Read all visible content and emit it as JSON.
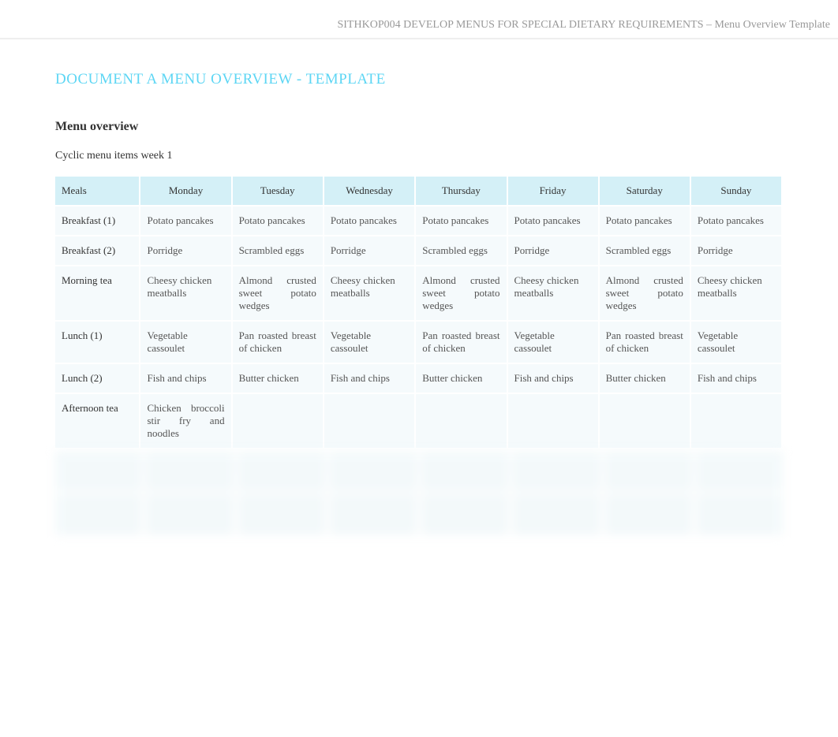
{
  "header_text": "SITHKOP004 DEVELOP MENUS FOR SPECIAL DIETARY REQUIREMENTS – Menu Overview Template",
  "doc_title": "DOCUMENT A MENU OVERVIEW - TEMPLATE",
  "section_heading": "Menu overview",
  "subtext": "Cyclic menu items week 1",
  "table": {
    "headers": [
      "Meals",
      "Monday",
      "Tuesday",
      "Wednesday",
      "Thursday",
      "Friday",
      "Saturday",
      "Sunday"
    ],
    "rows": [
      {
        "label": "Breakfast (1)",
        "cells": [
          "Potato pancakes",
          "Potato pancakes",
          "Potato pancakes",
          "Potato pancakes",
          "Potato pancakes",
          "Potato pancakes",
          "Potato pancakes"
        ]
      },
      {
        "label": "Breakfast (2)",
        "cells": [
          "Porridge",
          "Scrambled eggs",
          "Porridge",
          "Scrambled eggs",
          "Porridge",
          "Scrambled eggs",
          "Porridge"
        ]
      },
      {
        "label": "Morning tea",
        "cells": [
          "Cheesy chicken meatballs",
          "Almond crusted sweet potato wedges",
          "Cheesy chicken meatballs",
          "Almond crusted sweet potato wedges",
          "Cheesy chicken meatballs",
          "Almond crusted sweet potato wedges",
          "Cheesy chicken meatballs"
        ]
      },
      {
        "label": "Lunch (1)",
        "cells": [
          "Vegetable cassoulet",
          "Pan roasted breast of chicken",
          "Vegetable cassoulet",
          "Pan roasted breast of chicken",
          "Vegetable cassoulet",
          "Pan roasted breast of chicken",
          "Vegetable cassoulet"
        ]
      },
      {
        "label": "Lunch (2)",
        "cells": [
          "Fish and chips",
          "Butter chicken",
          "Fish and chips",
          "Butter chicken",
          "Fish and chips",
          "Butter chicken",
          "Fish and chips"
        ]
      },
      {
        "label": "Afternoon tea",
        "cells": [
          "Chicken broccoli stir fry and noodles",
          "",
          "",
          "",
          "",
          "",
          ""
        ]
      }
    ]
  }
}
